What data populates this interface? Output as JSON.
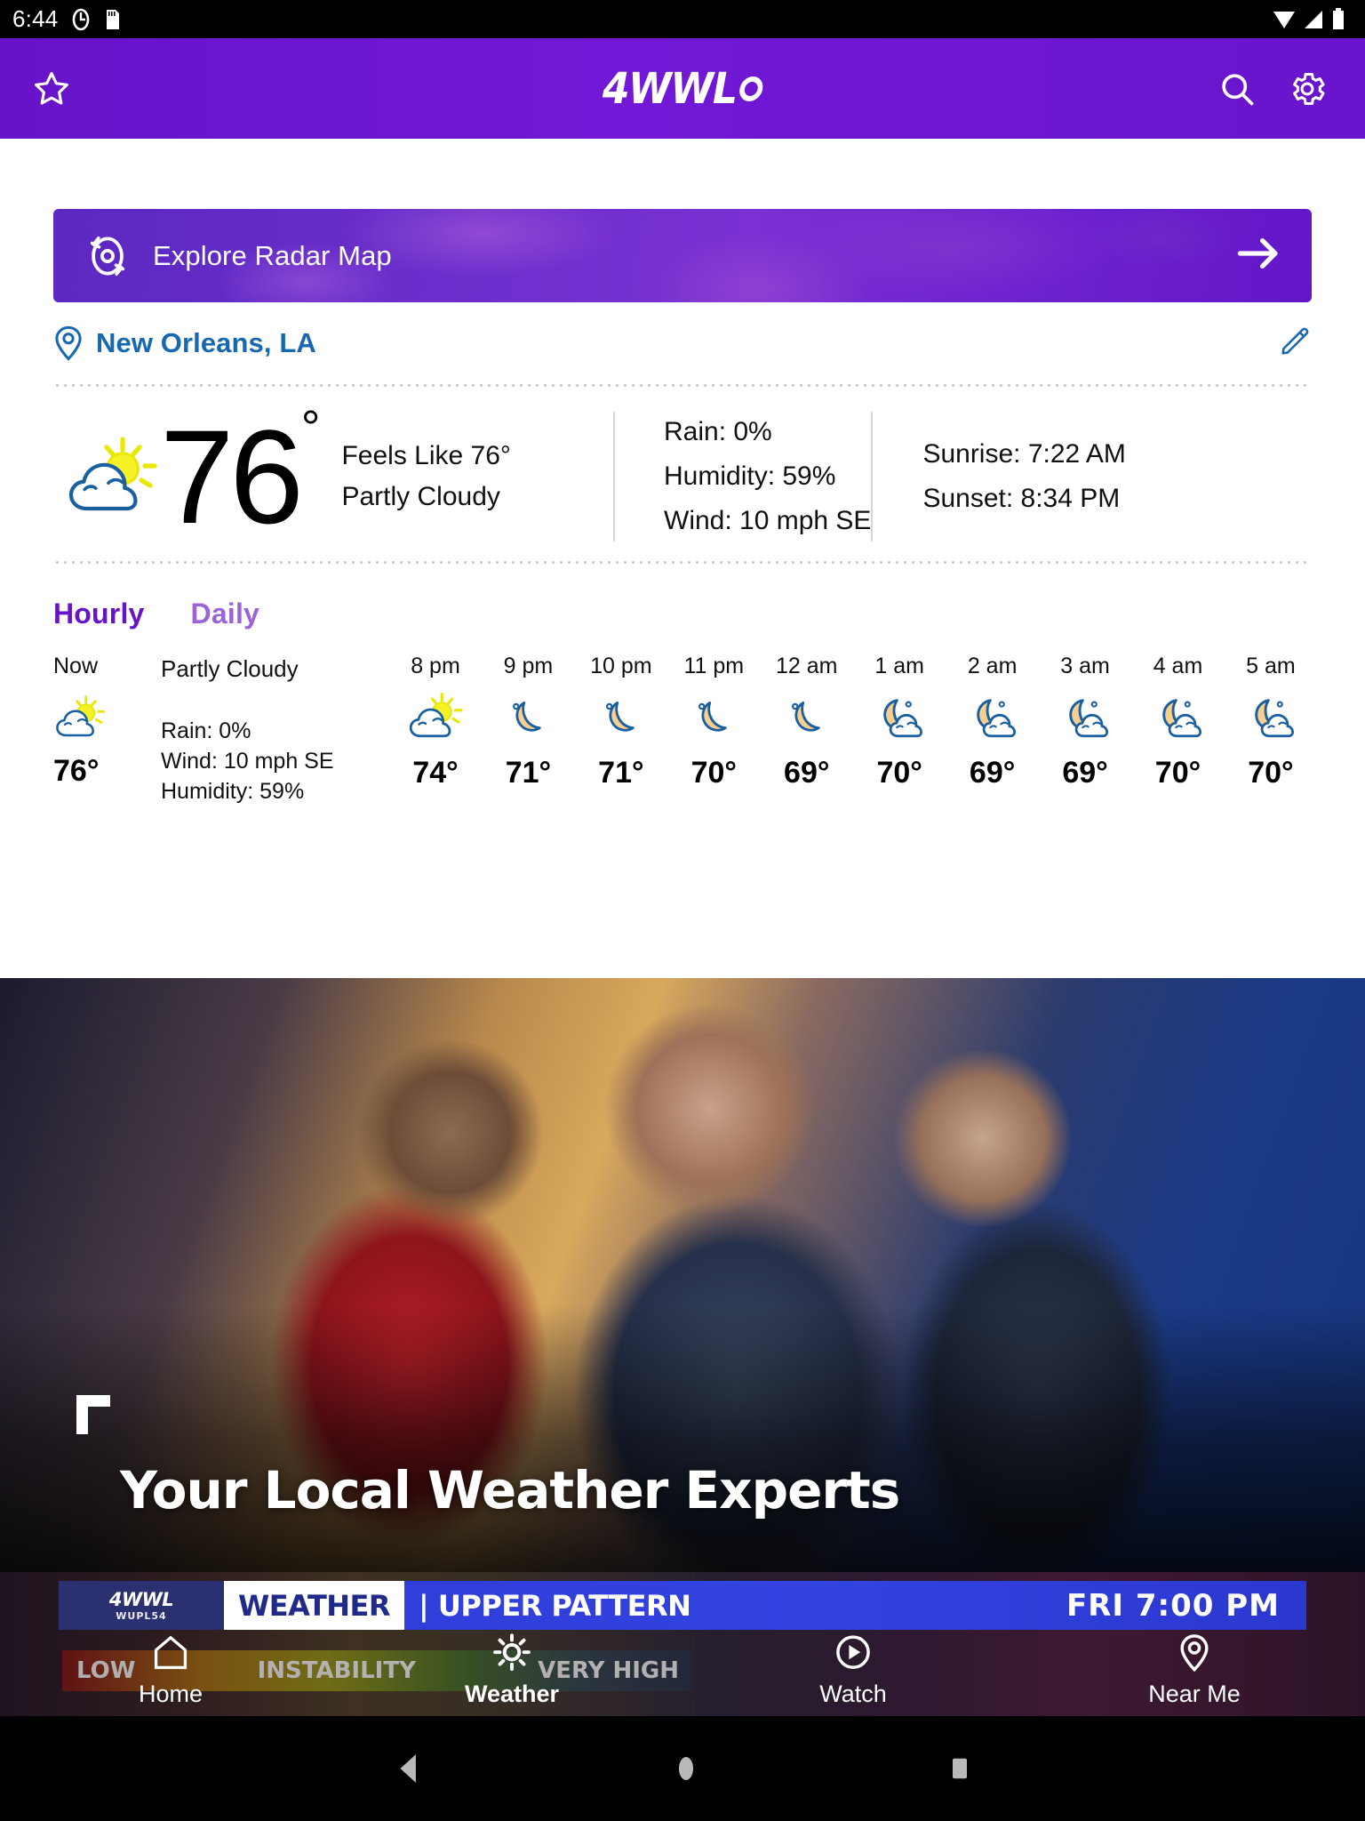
{
  "status_bar": {
    "time": "6:44",
    "left_icons": [
      "clock-icon",
      "sd-card-icon"
    ],
    "right_icons": [
      "wifi-icon",
      "signal-icon",
      "battery-icon"
    ]
  },
  "app_header": {
    "favorite_icon": "star-icon",
    "logo_text": "4WWL",
    "search_icon": "search-icon",
    "settings_icon": "gear-icon"
  },
  "radar_banner": {
    "icon": "radar-target-icon",
    "label": "Explore Radar Map",
    "arrow_icon": "arrow-right-icon"
  },
  "location": {
    "pin_icon": "location-pin-icon",
    "name": "New Orleans, LA",
    "edit_icon": "pencil-edit-icon",
    "color": "#1668b3"
  },
  "current": {
    "icon": "partly-cloudy-day-icon",
    "temperature": "76",
    "degree": "°",
    "feels_like": "Feels Like 76°",
    "condition": "Partly Cloudy",
    "stats": [
      "Rain: 0%",
      "Humidity: 59%",
      "Wind: 10 mph SE"
    ],
    "sun": [
      "Sunrise: 7:22 AM",
      "Sunset: 8:34 PM"
    ]
  },
  "forecast_tabs": {
    "active": "Hourly",
    "inactive": "Daily",
    "active_color": "#6613c9",
    "inactive_color": "#9a63d6"
  },
  "now_column": {
    "label": "Now",
    "icon": "partly-cloudy-day-icon",
    "temp": "76°",
    "condition": "Partly Cloudy",
    "details": [
      "Rain: 0%",
      "Wind: 10 mph SE",
      "Humidity: 59%"
    ]
  },
  "hourly": [
    {
      "time": "8 pm",
      "icon": "partly-cloudy-day-icon",
      "temp": "74°"
    },
    {
      "time": "9 pm",
      "icon": "clear-night-icon",
      "temp": "71°"
    },
    {
      "time": "10 pm",
      "icon": "clear-night-icon",
      "temp": "71°"
    },
    {
      "time": "11 pm",
      "icon": "clear-night-icon",
      "temp": "70°"
    },
    {
      "time": "12 am",
      "icon": "clear-night-icon",
      "temp": "69°"
    },
    {
      "time": "1 am",
      "icon": "partly-cloudy-night-icon",
      "temp": "70°"
    },
    {
      "time": "2 am",
      "icon": "partly-cloudy-night-icon",
      "temp": "69°"
    },
    {
      "time": "3 am",
      "icon": "partly-cloudy-night-icon",
      "temp": "69°"
    },
    {
      "time": "4 am",
      "icon": "partly-cloudy-night-icon",
      "temp": "70°"
    },
    {
      "time": "5 am",
      "icon": "partly-cloudy-night-icon",
      "temp": "70°"
    }
  ],
  "promo": {
    "headline": "Your Local Weather Experts"
  },
  "video_strip": {
    "station_logo": "4WWL",
    "station_sub": "WUPL54",
    "kicker": "WEATHER",
    "divider": "|",
    "title": "UPPER PATTERN",
    "timestamp": "FRI  7:00 PM",
    "scale_left": "LOW",
    "scale_mid": "INSTABILITY",
    "scale_right": "VERY HIGH"
  },
  "bottom_nav": {
    "items": [
      {
        "label": "Home",
        "icon": "home-icon",
        "active": false
      },
      {
        "label": "Weather",
        "icon": "sun-weather-icon",
        "active": true
      },
      {
        "label": "Watch",
        "icon": "play-circle-icon",
        "active": false
      },
      {
        "label": "Near Me",
        "icon": "location-pin-icon",
        "active": false
      }
    ]
  },
  "android_nav": {
    "back_icon": "triangle-back-icon",
    "home_icon": "circle-home-icon",
    "recents_icon": "square-recents-icon"
  }
}
